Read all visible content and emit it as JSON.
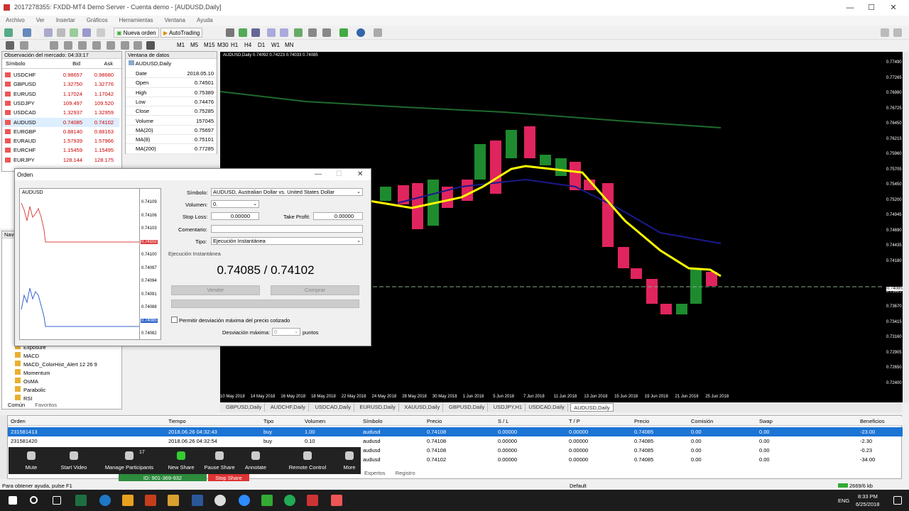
{
  "window": {
    "title": "2017278355: FXDD-MT4 Demo Server - Cuenta demo - [AUDUSD,Daily]"
  },
  "menu": [
    "Archivo",
    "Ver",
    "Insertar",
    "Gráficos",
    "Herramientas",
    "Ventana",
    "Ayuda"
  ],
  "toolbar": {
    "new_order": "Nueva orden",
    "autotrading": "AutoTrading",
    "periods": [
      "M1",
      "M5",
      "M15",
      "M30",
      "H1",
      "H4",
      "D1",
      "W1",
      "MN"
    ]
  },
  "market_watch": {
    "title": "Observación del mercado: 04:33:17",
    "cols": [
      "Símbolo",
      "Bid",
      "Ask"
    ],
    "rows": [
      [
        "USDCHF",
        "0.98657",
        "0.98680"
      ],
      [
        "GBPUSD",
        "1.32750",
        "1.32776"
      ],
      [
        "EURUSD",
        "1.17024",
        "1.17042"
      ],
      [
        "USDJPY",
        "109.497",
        "109.520"
      ],
      [
        "USDCAD",
        "1.32937",
        "1.32959"
      ],
      [
        "AUDUSD",
        "0.74085",
        "0.74102"
      ],
      [
        "EURGBP",
        "0.88140",
        "0.88163"
      ],
      [
        "EURAUD",
        "1.57939",
        "1.57966"
      ],
      [
        "EURCHF",
        "1.15459",
        "1.15495"
      ],
      [
        "EURJPY",
        "128.144",
        "128.175"
      ]
    ]
  },
  "data_window": {
    "title": "Ventana de datos",
    "symbol": "AUDUSD,Daily",
    "rows": [
      [
        "Date",
        "2018.05.10"
      ],
      [
        "Open",
        "0.74501"
      ],
      [
        "High",
        "0.75389"
      ],
      [
        "Low",
        "0.74476"
      ],
      [
        "Close",
        "0.75285"
      ],
      [
        "Volume",
        "157045"
      ],
      [
        "MA(20)",
        "0.75697"
      ],
      [
        "MA(8)",
        "0.75101"
      ],
      [
        "MA(200)",
        "0.77285"
      ]
    ]
  },
  "navigator": {
    "title": "Naveg",
    "items": [
      "Exposure",
      "MACD",
      "MACD_ColorHist_Alert  12 26 9",
      "Momentum",
      "OsMA",
      "Parabolic",
      "RSI"
    ],
    "tabs": [
      "Común",
      "Favoritos"
    ]
  },
  "chart": {
    "title": "AUDUSD,Daily  0.74092 0.74223 0.74033 0.74085",
    "price_axis": [
      "0.77490",
      "0.77265",
      "0.76980",
      "0.76725",
      "0.76450",
      "0.76215",
      "0.75960",
      "0.75705",
      "0.75450",
      "0.75200",
      "0.74945",
      "0.74690",
      "0.74435",
      "0.74180",
      "0.74085",
      "0.73925",
      "0.73670",
      "0.73415",
      "0.73160",
      "0.72905",
      "0.72650",
      "0.72400"
    ],
    "date_axis": [
      "10 May 2018",
      "14 May 2018",
      "16 May 2018",
      "18 May 2018",
      "22 May 2018",
      "24 May 2018",
      "28 May 2018",
      "30 May 2018",
      "1 Jun 2018",
      "5 Jun 2018",
      "7 Jun 2018",
      "11 Jun 2018",
      "13 Jun 2018",
      "15 Jun 2018",
      "19 Jun 2018",
      "21 Jun 2018",
      "25 Jun 2018"
    ],
    "current_price": "0.74085",
    "colors": {
      "bull": "#1e8b2e",
      "bear": "#e0245e",
      "ma_fast": "#ffff00",
      "ma_mid": "#1a1a8c",
      "ma_slow": "#1e6b2e"
    }
  },
  "chart_tabs": [
    "GBPUSD,Daily",
    "AUDCHF,Daily",
    "USDCAD,Daily",
    "EURUSD,Daily",
    "XAUUSD,Daily",
    "GBPUSD,Daily",
    "USDJPY,H1",
    "USDCAD,Daily",
    "AUDUSD,Daily"
  ],
  "order_dialog": {
    "title": "Orden",
    "chart_symbol": "AUDUSD",
    "chart_prices": [
      "0.74109",
      "0.74106",
      "0.74103",
      "0.74102",
      "0.74100",
      "0.74097",
      "0.74094",
      "0.74091",
      "0.74088",
      "0.74085",
      "0.74082"
    ],
    "symbol_label": "Símbolo:",
    "symbol_value": "AUDUSD, Australian Dollar vs. United States Dollar",
    "volume_label": "Volumen:",
    "volume_value": "0.",
    "sl_label": "Stop Loss:",
    "sl_value": "0.00000",
    "tp_label": "Take Profit:",
    "tp_value": "0.00000",
    "comment_label": "Comentario:",
    "type_label": "Tipo:",
    "type_value": "Ejecución Instantánea",
    "section": "Ejecución Instantánea",
    "price": "0.74085 / 0.74102",
    "sell": "Vender",
    "buy": "Comprar",
    "deviation_check": "Permitir desviación máxima del precio cotizado",
    "deviation_label": "Desviación máxima:",
    "deviation_value": "0",
    "deviation_unit": "puntos"
  },
  "terminal": {
    "cols": [
      "Orden",
      "Tiempo",
      "Tipo",
      "Volumen",
      "Símbolo",
      "Precio",
      "S / L",
      "T / P",
      "Precio",
      "Comisión",
      "Swap",
      "Beneficios"
    ],
    "rows": [
      [
        "231581413",
        "2018.06.26 04:32:43",
        "buy",
        "1.00",
        "audusd",
        "0.74108",
        "0.00000",
        "0.00000",
        "0.74085",
        "0.00",
        "0.00",
        "-23.00"
      ],
      [
        "231581420",
        "2018.06.26 04:32:54",
        "buy",
        "0.10",
        "audusd",
        "0.74108",
        "0.00000",
        "0.00000",
        "0.74085",
        "0.00",
        "0.00",
        "-2.30"
      ],
      [
        "",
        "",
        "",
        "0.10",
        "audusd",
        "0.74108",
        "0.00000",
        "0.00000",
        "0.74085",
        "0.00",
        "0.00",
        "-0.23"
      ],
      [
        "",
        "",
        "",
        "",
        "audusd",
        "0.74102",
        "0.00000",
        "0.00000",
        "0.74085",
        "0.00",
        "0.00",
        "-34.00"
      ]
    ],
    "tabs": [
      "Expertos",
      "Registro"
    ]
  },
  "zoom": {
    "participants": "17",
    "buttons": [
      "Mute",
      "Start Video",
      "Manage Participants",
      "New Share",
      "Pause Share",
      "Annotate",
      "Remote Control",
      "More"
    ],
    "id": "ID: 901-369-932",
    "stop": "Stop Share"
  },
  "status": {
    "help": "Para obtener ayuda, pulse F1",
    "profile": "Default",
    "net": "2669/6 kb"
  },
  "taskbar": {
    "lang": "ENG",
    "time": "8:33 PM",
    "date": "6/25/2018"
  }
}
